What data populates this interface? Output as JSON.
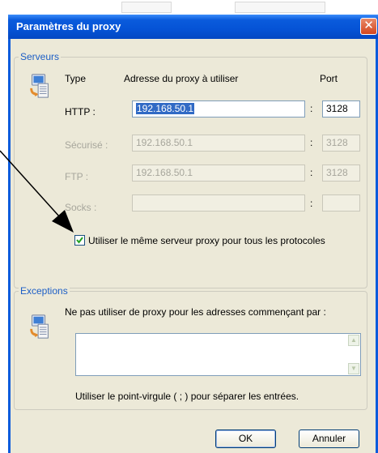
{
  "window": {
    "title": "Paramètres du proxy",
    "close_glyph": "✕"
  },
  "servers": {
    "legend": "Serveurs",
    "col_type": "Type",
    "col_address": "Adresse du proxy à utiliser",
    "col_port": "Port",
    "rows": [
      {
        "label": "HTTP :",
        "address": "192.168.50.1",
        "port": "3128",
        "enabled": true
      },
      {
        "label": "Sécurisé :",
        "address": "192.168.50.1",
        "port": "3128",
        "enabled": false
      },
      {
        "label": "FTP :",
        "address": "192.168.50.1",
        "port": "3128",
        "enabled": false
      },
      {
        "label": "Socks :",
        "address": "",
        "port": "",
        "enabled": false
      }
    ],
    "separator": ":",
    "same_server_label": "Utiliser le même serveur proxy pour tous les protocoles",
    "same_server_checked": true
  },
  "exceptions": {
    "legend": "Exceptions",
    "description": "Ne pas utiliser de proxy pour les adresses commençant par :",
    "value": "",
    "hint": "Utiliser le point-virgule ( ; ) pour séparer les entrées."
  },
  "buttons": {
    "ok": "OK",
    "cancel": "Annuler"
  },
  "icons": {
    "servers": "network-computer-icon",
    "exceptions": "network-computer-icon",
    "annotation": "arrow-annotation"
  }
}
